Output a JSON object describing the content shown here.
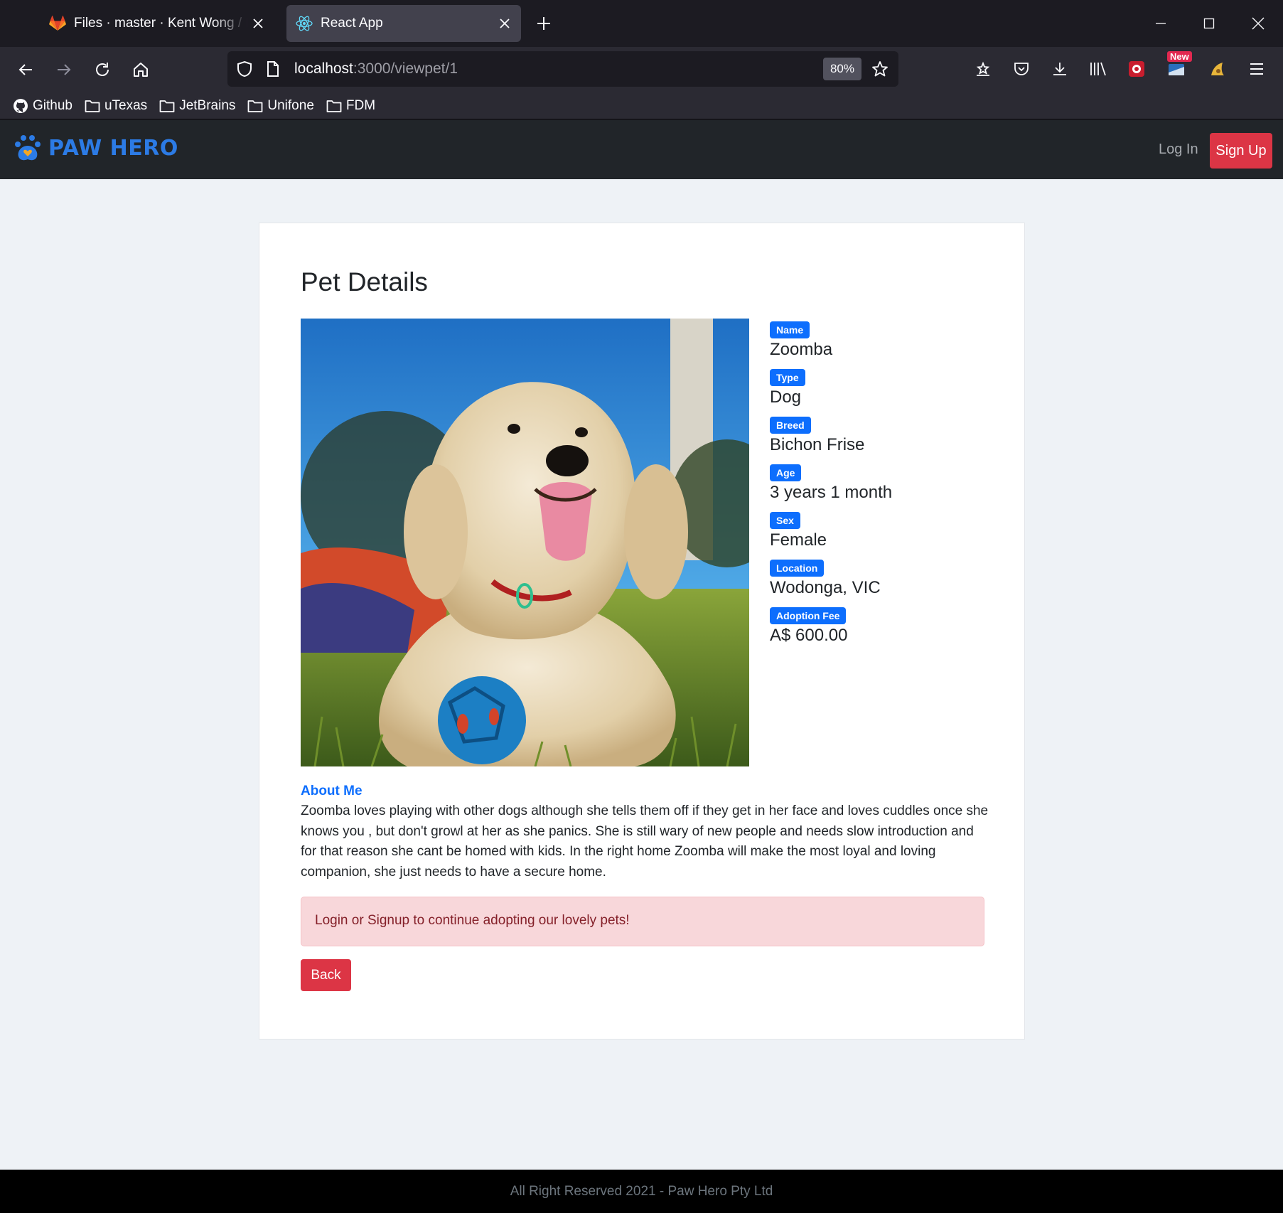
{
  "browser": {
    "tabs": [
      {
        "title": "Files · master · Kent Wong / Paw Hero",
        "favicon": "gitlab-icon",
        "active": false
      },
      {
        "title": "React App",
        "favicon": "react-icon",
        "active": true
      }
    ],
    "url_host": "localhost",
    "url_path": ":3000/viewpet/1",
    "zoom": "80%",
    "new_badge": "New",
    "bookmarks": [
      "Github",
      "uTexas",
      "JetBrains",
      "Unifone",
      "FDM"
    ]
  },
  "app": {
    "brand": "PAW HERO",
    "login": "Log In",
    "signup": "Sign Up",
    "brand_color": "#2c7be5"
  },
  "page": {
    "title": "Pet Details",
    "details": [
      {
        "label": "Name",
        "value": "Zoomba"
      },
      {
        "label": "Type",
        "value": "Dog"
      },
      {
        "label": "Breed",
        "value": "Bichon Frise"
      },
      {
        "label": "Age",
        "value": "3 years 1 month"
      },
      {
        "label": "Sex",
        "value": "Female"
      },
      {
        "label": "Location",
        "value": "Wodonga, VIC"
      },
      {
        "label": "Adoption Fee",
        "value": "A$ 600.00"
      }
    ],
    "about_title": "About Me",
    "about_text": "Zoomba loves playing with other dogs although she tells them off if they get in her face and loves cuddles once she knows you , but don't growl at her as she panics. She is still wary of new people and needs slow introduction and for that reason she cant be homed with kids. In the right home Zoomba will make the most loyal and loving companion, she just needs to have a secure home.",
    "alert": "Login or Signup to continue adopting our lovely pets!",
    "back": "Back"
  },
  "footer": "All Right Reserved 2021 - Paw Hero Pty Ltd"
}
